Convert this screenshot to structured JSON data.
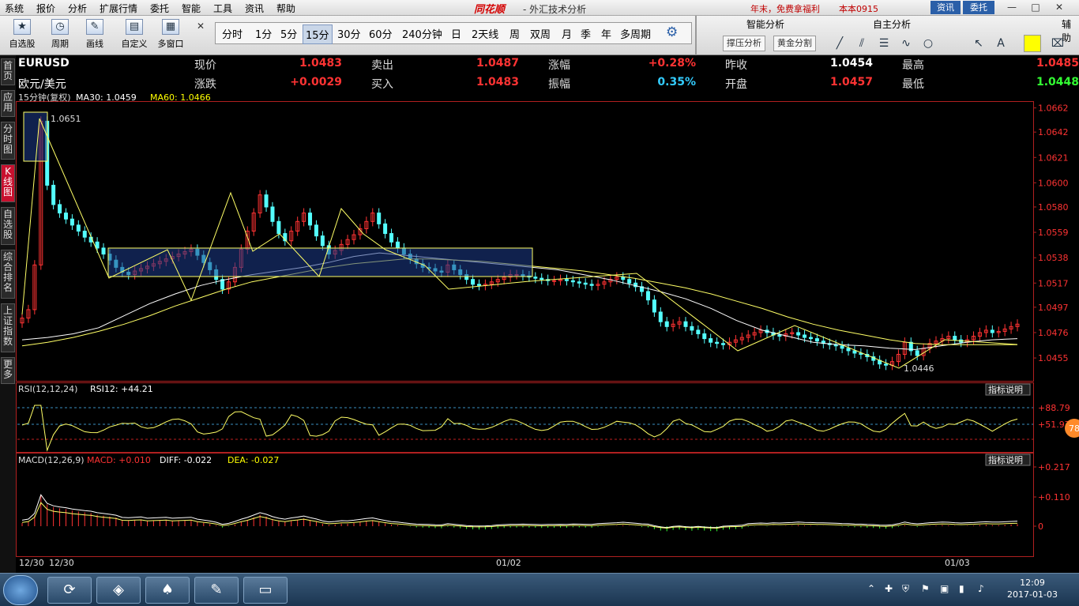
{
  "menu": [
    "系统",
    "报价",
    "分析",
    "扩展行情",
    "委托",
    "智能",
    "工具",
    "资讯",
    "帮助"
  ],
  "brand": "同花顺",
  "app_title": "- 外汇技术分析",
  "promo": "年末，免费拿福利",
  "user": "本本0915",
  "header_buttons": {
    "info": "资讯",
    "trade": "委托"
  },
  "toolbar_buttons": [
    {
      "label": "自选股",
      "icon": "★"
    },
    {
      "label": "周期",
      "icon": "◷"
    },
    {
      "label": "画线",
      "icon": "✎"
    },
    {
      "label": "自定义",
      "icon": "▤"
    },
    {
      "label": "多窗口",
      "icon": "▦"
    }
  ],
  "periods": [
    "分时",
    "1分",
    "5分",
    "15分",
    "30分",
    "60分",
    "240分钟",
    "日",
    "2天线",
    "周",
    "双周",
    "月",
    "季",
    "年",
    "多周期"
  ],
  "active_period": "15分",
  "panels": {
    "smart": "智能分析",
    "self": "自主分析",
    "aux": "辅助"
  },
  "smart_tools": [
    "撑压分析",
    "黄金分割"
  ],
  "side_tabs": [
    {
      "label": "首页",
      "active": false
    },
    {
      "label": "应用",
      "active": false
    },
    {
      "label": "分时图",
      "active": false
    },
    {
      "label": "K线图",
      "active": true
    },
    {
      "label": "自选股",
      "active": false
    },
    {
      "label": "综合排名",
      "active": false
    },
    {
      "label": "上证指数",
      "active": false
    },
    {
      "label": "更多",
      "active": false
    }
  ],
  "quote": {
    "symbol": "EURUSD",
    "name": "欧元/美元",
    "rows": [
      [
        {
          "label": "现价",
          "value": "1.0483",
          "color": "#ff3333"
        },
        {
          "label": "卖出",
          "value": "1.0487",
          "color": "#ff3333"
        },
        {
          "label": "涨幅",
          "value": "+0.28%",
          "color": "#ff3333"
        },
        {
          "label": "昨收",
          "value": "1.0454",
          "color": "#ffffff"
        },
        {
          "label": "最高",
          "value": "1.0485",
          "color": "#ff3333"
        }
      ],
      [
        {
          "label": "涨跌",
          "value": "+0.0029",
          "color": "#ff3333"
        },
        {
          "label": "买入",
          "value": "1.0483",
          "color": "#ff3333"
        },
        {
          "label": "振幅",
          "value": "0.35%",
          "color": "#33ccff"
        },
        {
          "label": "开盘",
          "value": "1.0457",
          "color": "#ff3333"
        },
        {
          "label": "最低",
          "value": "1.0448",
          "color": "#33ff33"
        }
      ]
    ]
  },
  "indicators": {
    "main": {
      "name": "15分钟(复权)",
      "ma30": "MA30: 1.0459",
      "ma60": "MA60: 1.0466"
    },
    "rsi": {
      "name": "RSI(12,12,24)",
      "value": "RSI12: +44.21"
    },
    "macd": {
      "name": "MACD(12,26,9)",
      "macd": "MACD: +0.010",
      "diff": "DIFF: -0.022",
      "dea": "DEA: -0.027"
    },
    "explain": "指标说明"
  },
  "axes": {
    "price": [
      "1.0662",
      "1.0642",
      "1.0621",
      "1.0600",
      "1.0580",
      "1.0559",
      "1.0538",
      "1.0517",
      "1.0497",
      "1.0476",
      "1.0455"
    ],
    "rsi": [
      "+88.79",
      "+51.97"
    ],
    "macd": [
      "+0.217",
      "+0.110",
      "0"
    ],
    "dates": [
      "12/30",
      "12/30",
      "01/02",
      "01/03"
    ]
  },
  "annotations": {
    "high": "1.0651",
    "low": "1.0446"
  },
  "badge": "78",
  "chart_data": {
    "type": "candlestick",
    "price_axis_range": [
      1.044,
      1.0665
    ],
    "candles": {
      "close": [
        1.0488,
        1.0495,
        1.0532,
        1.0651,
        1.0598,
        1.0582,
        1.0575,
        1.057,
        1.0565,
        1.056,
        1.0555,
        1.0551,
        1.0546,
        1.0541,
        1.0536,
        1.053,
        1.0526,
        1.0524,
        1.0527,
        1.0529,
        1.0531,
        1.0533,
        1.0535,
        1.0537,
        1.0539,
        1.0541,
        1.0543,
        1.0545,
        1.054,
        1.0534,
        1.0528,
        1.052,
        1.0512,
        1.0518,
        1.053,
        1.0545,
        1.056,
        1.0575,
        1.059,
        1.058,
        1.0568,
        1.0558,
        1.0552,
        1.056,
        1.0568,
        1.0575,
        1.0565,
        1.0556,
        1.0548,
        1.0541,
        1.0544,
        1.0549,
        1.0553,
        1.0557,
        1.0562,
        1.0568,
        1.0575,
        1.0566,
        1.0558,
        1.0551,
        1.0546,
        1.0541,
        1.0537,
        1.0533,
        1.053,
        1.0529,
        1.0527,
        1.0526,
        1.0532,
        1.0528,
        1.0524,
        1.052,
        1.0516,
        1.0515,
        1.0516,
        1.0518,
        1.052,
        1.0522,
        1.0524,
        1.0524,
        1.0523,
        1.0522,
        1.0521,
        1.052,
        1.0519,
        1.0519,
        1.052,
        1.0519,
        1.0518,
        1.0517,
        1.0516,
        1.0515,
        1.0516,
        1.0518,
        1.052,
        1.0522,
        1.052,
        1.0517,
        1.0514,
        1.051,
        1.0503,
        1.0493,
        1.0485,
        1.0481,
        1.0483,
        1.0485,
        1.0481,
        1.0478,
        1.0475,
        1.0471,
        1.0468,
        1.0467,
        1.0466,
        1.0468,
        1.047,
        1.0472,
        1.0474,
        1.0476,
        1.0478,
        1.0476,
        1.0474,
        1.0473,
        1.0475,
        1.0476,
        1.0474,
        1.0472,
        1.0471,
        1.0469,
        1.0467,
        1.0466,
        1.0465,
        1.0463,
        1.0461,
        1.0459,
        1.0458,
        1.0456,
        1.0453,
        1.045,
        1.0449,
        1.0452,
        1.0458,
        1.0468,
        1.0461,
        1.0457,
        1.0463,
        1.0467,
        1.0469,
        1.0471,
        1.0473,
        1.047,
        1.0468,
        1.047,
        1.0473,
        1.0476,
        1.0478,
        1.0476,
        1.0477,
        1.0479,
        1.0481,
        1.0483
      ]
    },
    "ma30": [
      1.047,
      1.0472,
      1.0475,
      1.048,
      1.049,
      1.05,
      1.0508,
      1.0515,
      1.052,
      1.0524,
      1.0527,
      1.053,
      1.0534,
      1.0539,
      1.0542,
      1.054,
      1.0538,
      1.0536,
      1.0534,
      1.0532,
      1.053,
      1.0528,
      1.0524,
      1.052,
      1.0515,
      1.051,
      1.0504,
      1.0496,
      1.0486,
      1.0478,
      1.0473,
      1.0468,
      1.0466,
      1.0465,
      1.0463,
      1.0462,
      1.0465,
      1.0468,
      1.047,
      1.0471
    ],
    "ma60": [
      1.0465,
      1.0468,
      1.0472,
      1.0477,
      1.0483,
      1.049,
      1.0498,
      1.0505,
      1.0512,
      1.0518,
      1.0522,
      1.0526,
      1.053,
      1.0533,
      1.0535,
      1.0537,
      1.0537,
      1.0536,
      1.0535,
      1.0533,
      1.0531,
      1.0529,
      1.0527,
      1.0524,
      1.0521,
      1.0517,
      1.0513,
      1.0508,
      1.0502,
      1.0496,
      1.0489,
      1.0483,
      1.0478,
      1.0474,
      1.047,
      1.0467,
      1.0466,
      1.0466,
      1.0466,
      1.0466
    ]
  },
  "taskbar": {
    "time": "12:09",
    "date": "2017-01-03"
  }
}
